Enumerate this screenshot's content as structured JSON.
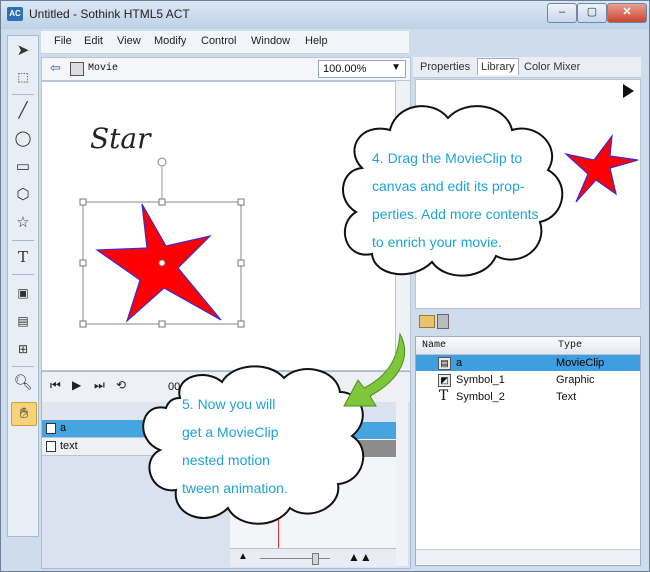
{
  "window": {
    "title": "Untitled - Sothink HTML5 ACT",
    "app_icon_label": "AC",
    "controls": [
      "–",
      "▢",
      "✕"
    ]
  },
  "menu": [
    "File",
    "Edit",
    "View",
    "Modify",
    "Control",
    "Window",
    "Help"
  ],
  "stage_bar": {
    "scene_label": "Movie",
    "zoom": "100.00%"
  },
  "stage": {
    "title_text": "Star"
  },
  "timeline": {
    "time": "00:00:05",
    "layers": [
      {
        "name": "a",
        "selected": true
      },
      {
        "name": "text",
        "selected": false
      }
    ]
  },
  "panel": {
    "tabs": [
      "Properties",
      "Library",
      "Color Mixer"
    ],
    "active_tab": "Library"
  },
  "library": {
    "columns": [
      "Name",
      "Type"
    ],
    "items": [
      {
        "name": "a",
        "type": "MovieClip",
        "icon": "movieclip-icon"
      },
      {
        "name": "Symbol_1",
        "type": "Graphic",
        "icon": "graphic-icon"
      },
      {
        "name": "Symbol_2",
        "type": "Text",
        "icon": "text-icon"
      }
    ]
  },
  "callouts": {
    "step4": [
      "4. Drag the MovieClip to",
      "canvas and edit its prop-",
      "perties. Add more contents",
      "to enrich your movie."
    ],
    "step5": [
      "5. Now you will",
      "get a MovieClip",
      "nested motion",
      "tween animation."
    ]
  },
  "colors": {
    "star_fill": "#ff0000",
    "star_stroke": "#3d2bd6",
    "callout_text": "#1ea3d8",
    "selection": "#3f9ee0",
    "arrow": "#7ec63a"
  }
}
